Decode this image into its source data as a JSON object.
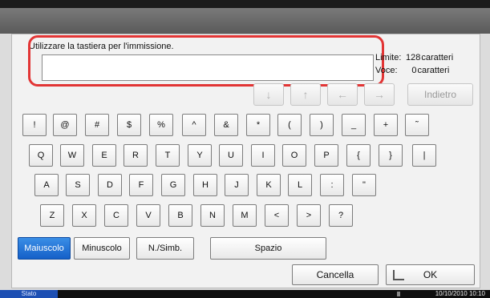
{
  "dialog": {
    "prompt": "Utilizzare la tastiera per l'immissione.",
    "input_value": "",
    "limit_label": "Limite:",
    "limit_value": "128",
    "limit_unit": "caratteri",
    "used_label": "Voce:",
    "used_value": "0",
    "used_unit": "caratteri"
  },
  "nav": {
    "down": "↓",
    "up": "↑",
    "left": "←",
    "right": "→",
    "back_label": "Indietro"
  },
  "keyboard": {
    "row1": [
      "!",
      "@",
      "#",
      "$",
      "%",
      "^",
      "&",
      "*",
      "(",
      ")",
      "_",
      "+",
      "˜"
    ],
    "row2": [
      "Q",
      "W",
      "E",
      "R",
      "T",
      "Y",
      "U",
      "I",
      "O",
      "P",
      "{",
      "}",
      "|"
    ],
    "row3": [
      "A",
      "S",
      "D",
      "F",
      "G",
      "H",
      "J",
      "K",
      "L",
      ":",
      "\""
    ],
    "row4": [
      "Z",
      "X",
      "C",
      "V",
      "B",
      "N",
      "M",
      "<",
      ">",
      "?"
    ]
  },
  "modes": {
    "uppercase": "Maiuscolo",
    "lowercase": "Minuscolo",
    "numsym": "N./Simb.",
    "space": "Spazio"
  },
  "actions": {
    "cancel": "Cancella",
    "ok": "OK"
  },
  "status": {
    "label": "Stato",
    "datetime": "10/10/2010  10:10"
  },
  "colors": {
    "accent": "#1560c8",
    "highlight": "#e23535"
  }
}
